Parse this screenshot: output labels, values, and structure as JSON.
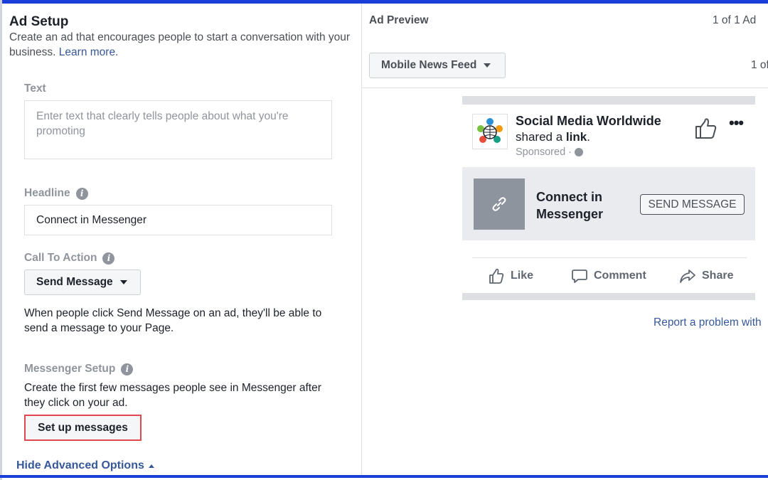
{
  "ad_setup": {
    "title": "Ad Setup",
    "subtitle": "Create an ad that encourages people to start a conversation with your business.",
    "learn_more": "Learn more.",
    "text_section": {
      "label": "Text",
      "placeholder": "Enter text that clearly tells people about what you're promoting"
    },
    "headline_section": {
      "label": "Headline",
      "value": "Connect in Messenger"
    },
    "cta_section": {
      "label": "Call To Action",
      "selected": "Send Message",
      "help": "When people click Send Message on an ad, they'll be able to send a message to your Page."
    },
    "messenger_section": {
      "label": "Messenger Setup",
      "help": "Create the first few messages people see in Messenger after they click on your ad.",
      "button": "Set up messages"
    },
    "hide_advanced": "Hide Advanced Options"
  },
  "ad_preview": {
    "title": "Ad Preview",
    "count": "1 of 1 Ad",
    "placement": "Mobile News Feed",
    "pager": "1 of",
    "post": {
      "page_name": "Social Media Worldwide",
      "shared_prefix": "shared a",
      "shared_link": "link",
      "shared_suffix": ".",
      "sponsored": "Sponsored ·",
      "link_title": "Connect in Messenger",
      "cta_button": "SEND MESSAGE",
      "actions": [
        "Like",
        "Comment",
        "Share"
      ]
    },
    "report": "Report a problem with"
  },
  "colors": {
    "accent_border": "#1a3ed8",
    "link": "#365899",
    "highlight": "#e0474f"
  }
}
